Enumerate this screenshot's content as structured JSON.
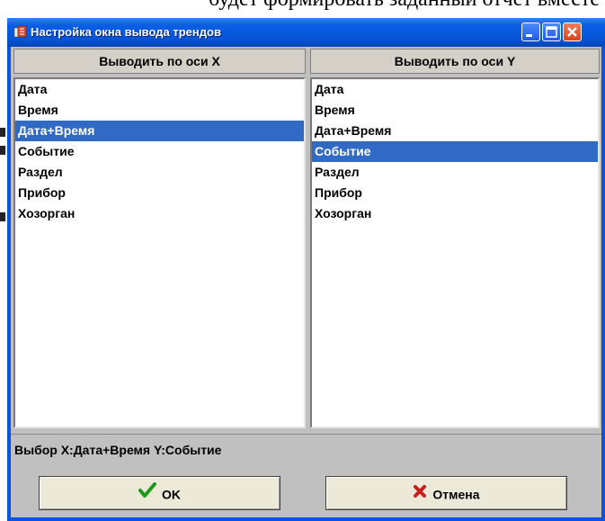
{
  "background": {
    "text_fragment": "будет формировать заданный отчет вместе с н"
  },
  "window": {
    "title": "Настройка окна вывода трендов",
    "icons": {
      "app": "app-icon",
      "minimize": "minimize-icon",
      "maximize": "maximize-icon",
      "close": "close-icon"
    }
  },
  "axis_x": {
    "header": "Выводить по оси X",
    "items": [
      "Дата",
      "Время",
      "Дата+Время",
      "Событие",
      "Раздел",
      "Прибор",
      "Хозорган"
    ],
    "selected": "Дата+Время"
  },
  "axis_y": {
    "header": "Выводить по оси Y",
    "items": [
      "Дата",
      "Время",
      "Дата+Время",
      "Событие",
      "Раздел",
      "Прибор",
      "Хозорган"
    ],
    "selected": "Событие"
  },
  "status": {
    "text": "Выбор X:Дата+Время Y:Событие"
  },
  "buttons": {
    "ok_label": "OK",
    "ok_icon": "check-icon",
    "cancel_label": "Отмена",
    "cancel_icon": "cross-icon"
  },
  "colors": {
    "selection": "#316ac5",
    "titlebar": "#0a5fe6",
    "ok_icon": "#1a9a1a",
    "cancel_icon": "#c81e1e"
  }
}
